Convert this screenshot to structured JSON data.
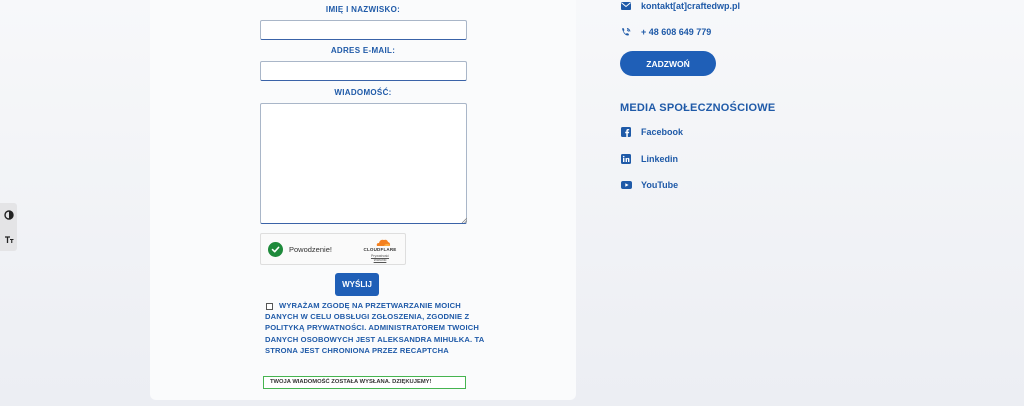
{
  "form": {
    "name_label": "IMIĘ I NAZWISKO:",
    "email_label": "ADRES E-MAIL:",
    "message_label": "WIADOMOŚĆ:",
    "name_value": "",
    "email_value": "",
    "message_value": "",
    "submit_label": "WYŚLIJ",
    "consent_checked": false,
    "consent_text": "WYRAŻAM ZGODĘ NA PRZETWARZANIE MOICH DANYCH W CELU OBSŁUGI ZGŁOSZENIA, ZGODNIE Z POLITYKĄ PRYWATNOŚCI. ADMINISTRATOREM TWOICH DANYCH OSOBOWYCH JEST ALEKSANDRA MIHUŁKA. TA STRONA JEST CHRONIONA PRZEZ RECAPTCHA",
    "success_message": "TWOJA WIADOMOŚĆ ZOSTAŁA WYSŁANA. DZIĘKUJEMY!"
  },
  "captcha": {
    "status": "Powodzenie!",
    "brand": "CLOUDFLARE",
    "privacy_link": "Prywatność",
    "terms_link": "Warunki"
  },
  "contact": {
    "email": "kontakt[at]craftedwp.pl",
    "phone": "+ 48 608 649 779",
    "call_button": "ZADZWOŃ"
  },
  "social": {
    "heading": "MEDIA SPOŁECZNOŚCIOWE",
    "items": [
      {
        "label": "Facebook",
        "icon": "facebook-icon"
      },
      {
        "label": "Linkedin",
        "icon": "linkedin-icon"
      },
      {
        "label": "YouTube",
        "icon": "youtube-icon"
      }
    ]
  },
  "accessibility": {
    "contrast_icon": "contrast-icon",
    "text_size_icon": "text-size-icon"
  },
  "colors": {
    "accent": "#1f5fb7",
    "label_blue": "#1f5aa8",
    "success_border": "#46b450",
    "captcha_check": "#1e8a3b"
  }
}
